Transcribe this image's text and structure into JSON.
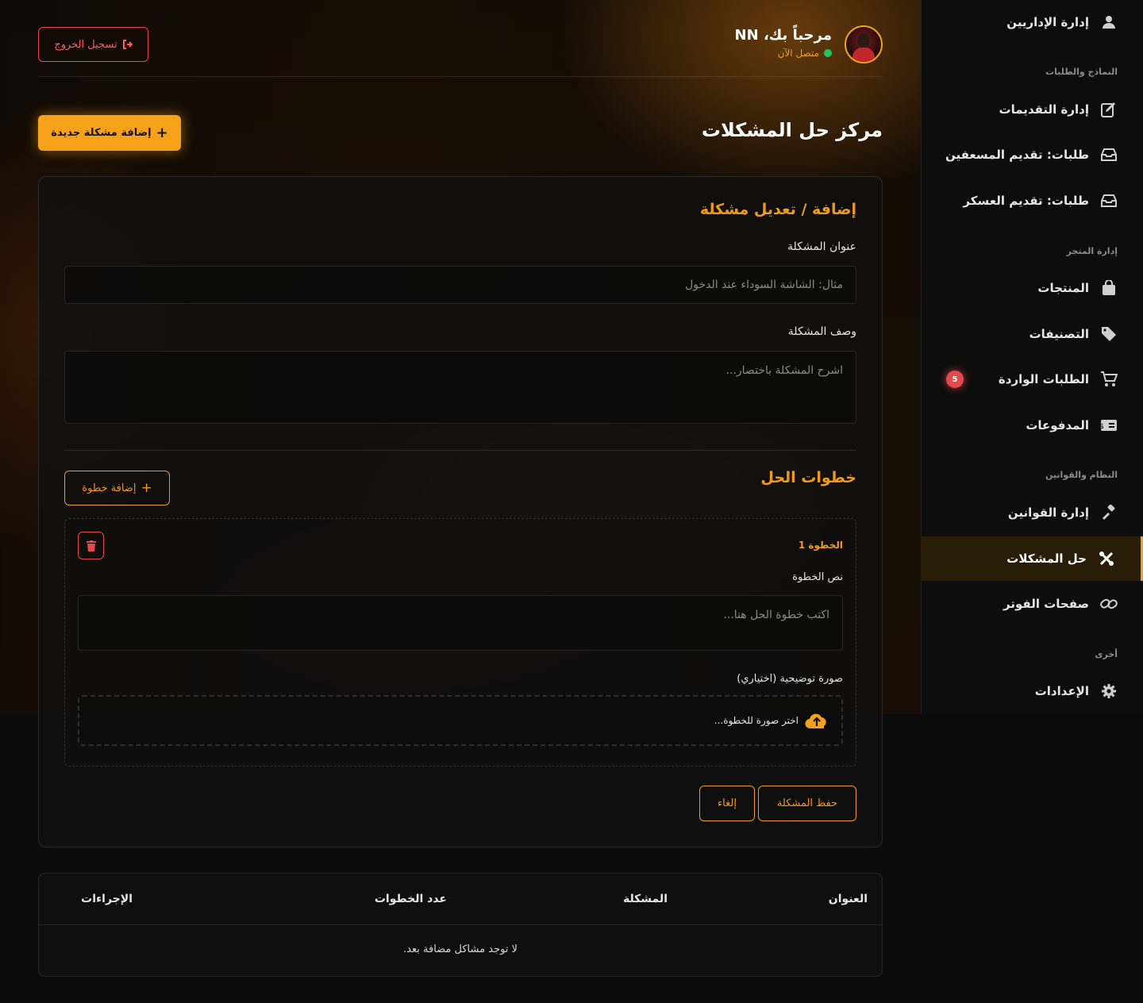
{
  "header": {
    "welcome": "مرحباً بك، NN",
    "status": "متصل الآن",
    "logout_label": "تسجيل الخروج"
  },
  "page": {
    "title": "مركز حل المشكلات",
    "add_problem_label": "إضافة مشكلة جديدة"
  },
  "sidebar": {
    "items": [
      {
        "label": "إدارة الإداريين",
        "icon": "user-icon"
      },
      {
        "label": "إدارة التقديمات",
        "icon": "edit-document-icon"
      },
      {
        "label": "طلبات: تقديم المسعفين",
        "icon": "inbox-icon"
      },
      {
        "label": "طلبات: تقديم العسكر",
        "icon": "inbox-icon"
      },
      {
        "label": "المنتجات",
        "icon": "shopping-bag-icon"
      },
      {
        "label": "التصنيفات",
        "icon": "tags-icon"
      },
      {
        "label": "الطلبات الواردة",
        "icon": "cart-icon",
        "badge": "5"
      },
      {
        "label": "المدفوعات",
        "icon": "money-bill-icon"
      },
      {
        "label": "إدارة القوانين",
        "icon": "gavel-icon"
      },
      {
        "label": "حل المشكلات",
        "icon": "tools-icon",
        "active": true
      },
      {
        "label": "صفحات الفوتر",
        "icon": "link-icon"
      },
      {
        "label": "الإعدادات",
        "icon": "gear-icon"
      }
    ],
    "sections": [
      "النماذج والطلبات",
      "إدارة المتجر",
      "النظام والقوانين",
      "أخرى"
    ]
  },
  "form": {
    "heading": "إضافة / تعديل مشكلة",
    "title_label": "عنوان المشكلة",
    "title_placeholder": "مثال: الشاشة السوداء عند الدخول",
    "title_value": "",
    "desc_label": "وصف المشكلة",
    "desc_placeholder": "اشرح المشكلة باختصار...",
    "desc_value": "",
    "steps_heading": "خطوات الحل",
    "add_step_label": "إضافة خطوة",
    "steps": [
      {
        "title": "الخطوة 1",
        "text_label": "نص الخطوة",
        "text_placeholder": "اكتب خطوة الحل هنا...",
        "image_label": "صورة توضيحية (اختياري)",
        "upload_label": "اختر صورة للخطوة..."
      }
    ],
    "save_label": "حفظ المشكلة",
    "cancel_label": "إلغاء"
  },
  "table": {
    "columns": [
      "العنوان",
      "المشكلة",
      "عدد الخطوات",
      "الإجراءات"
    ],
    "empty_message": "لا توجد مشاكل مضافة بعد."
  },
  "colors": {
    "accent": "#f5a11a",
    "danger": "#e5484d",
    "online": "#22c55e"
  }
}
